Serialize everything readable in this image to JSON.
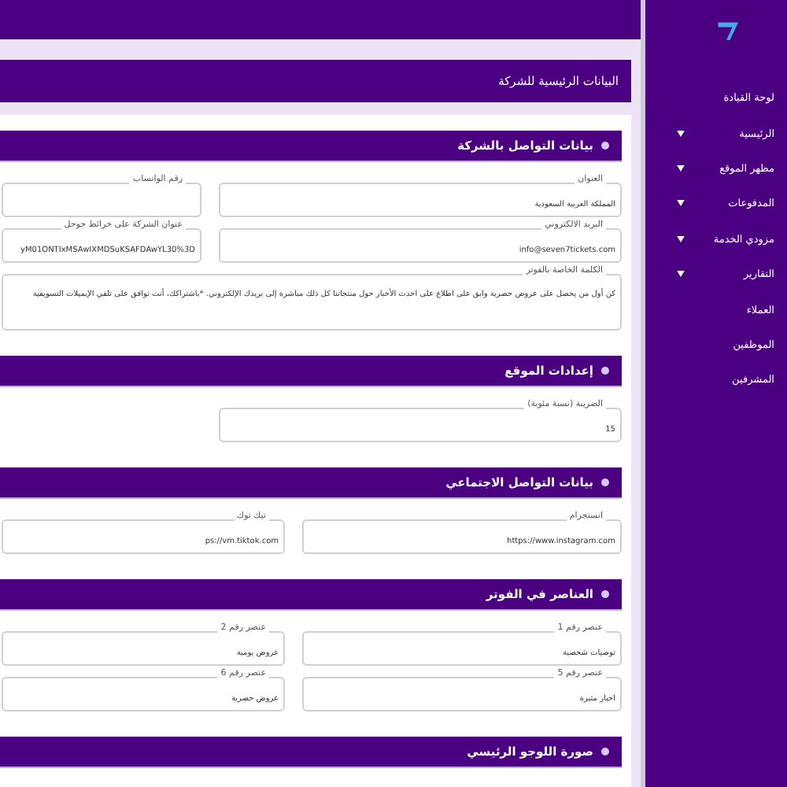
{
  "sidebar": {
    "items": [
      {
        "label": "لوحة القيادة",
        "expandable": false
      },
      {
        "label": "الرئيسية",
        "expandable": true
      },
      {
        "label": "مظهر الموقع",
        "expandable": true
      },
      {
        "label": "المدفوعات",
        "expandable": true
      },
      {
        "label": "مزودي الخدمة",
        "expandable": true
      },
      {
        "label": "التقارير",
        "expandable": true
      },
      {
        "label": "العملاء",
        "expandable": false
      },
      {
        "label": "الموظفين",
        "expandable": false
      },
      {
        "label": "المشرفين",
        "expandable": false
      }
    ]
  },
  "page_title": "البيانات الرئيسية للشركة",
  "sections": [
    {
      "title": "بيانات التواصل بالشركة",
      "fields": [
        {
          "label": "العنوان",
          "value": "المملكة العربية السعودية",
          "kind": "input"
        },
        {
          "label": "رقم الواتساب",
          "kind": "input"
        },
        {
          "label": "البريد الالكتروني",
          "value": "info@seven7tickets.com",
          "kind": "input"
        },
        {
          "label": "عنوان الشركة على خرائط جوجل",
          "value": "yM01ONTIxMSAwIXMDSuKSAFDAwYL30%3D",
          "kind": "input"
        },
        {
          "label": "الكلمة الخاصة بالفوتر",
          "value": "كن أول من يحصل على عروض حصرية وابق على اطلاع على احدث الأخبار حول منتجاتنا كل ذلك مباشرة إلى بريدك الإلكتروني. *باشتراكك، أنت توافق على تلقي الإيميلات التسويقية",
          "kind": "textarea"
        }
      ]
    },
    {
      "title": "إعدادات الموقع",
      "fields": [
        {
          "label": "الضريبة (نسبة مئوية)",
          "value": "15",
          "kind": "input"
        }
      ]
    },
    {
      "title": "بيانات التواصل الاجتماعي",
      "fields": [
        {
          "label": "انستجرام",
          "value": "https://www.instagram.com",
          "kind": "input"
        },
        {
          "label": "تيك توك",
          "value": "ps://vm.tiktok.com",
          "kind": "input"
        }
      ]
    },
    {
      "title": "العناصر في الفوتر",
      "fields": [
        {
          "label": "عنصر رقم 1",
          "value": "توصيات شخصية",
          "kind": "input"
        },
        {
          "label": "عنصر رقم 2",
          "value": "عروض يومية",
          "kind": "input"
        },
        {
          "label": "عنصر رقم 5",
          "value": "اخبار مثيرة",
          "kind": "input"
        },
        {
          "label": "عنصر رقم 6",
          "value": "عروض حصرية",
          "kind": "input"
        }
      ]
    },
    {
      "title": "صورة اللوجو الرئيسي"
    }
  ]
}
